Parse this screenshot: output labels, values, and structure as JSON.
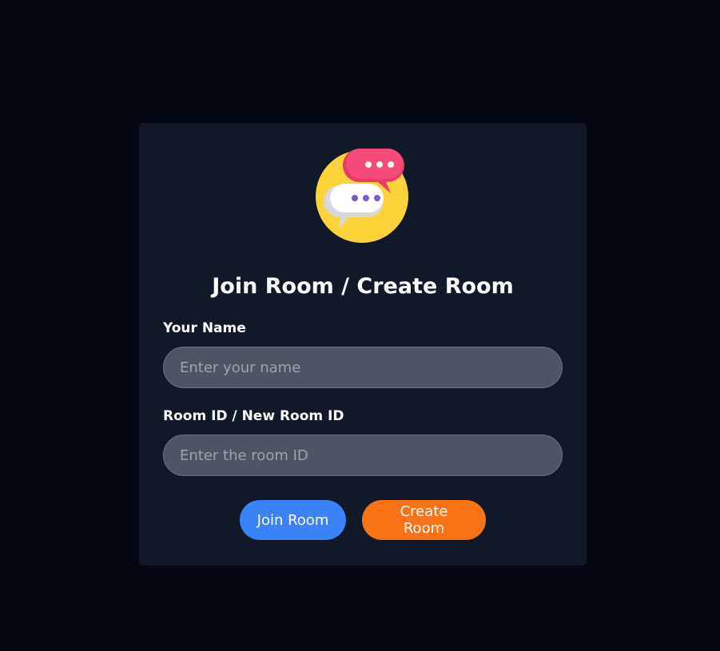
{
  "card": {
    "logo_icon": "chat-bubbles-icon",
    "title": "Join Room / Create Room"
  },
  "form": {
    "name_label": "Your Name",
    "name_placeholder": "Enter your name",
    "name_value": "",
    "room_label": "Room ID / New Room ID",
    "room_placeholder": "Enter the room ID",
    "room_value": ""
  },
  "buttons": {
    "join_label": "Join Room",
    "create_label": "Create Room"
  },
  "colors": {
    "background": "#030712",
    "card": "#111827",
    "input": "#4b5563",
    "join": "#3b82f6",
    "create": "#f97316"
  }
}
